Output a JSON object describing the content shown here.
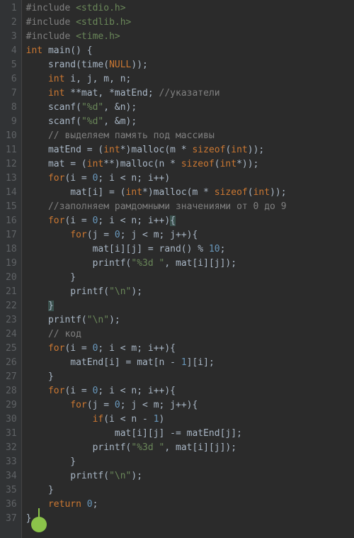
{
  "lines": [
    {
      "n": "1",
      "tokens": [
        {
          "c": "pp",
          "t": "#include "
        },
        {
          "c": "inc",
          "t": "<stdio.h>"
        }
      ]
    },
    {
      "n": "2",
      "tokens": [
        {
          "c": "pp",
          "t": "#include "
        },
        {
          "c": "inc",
          "t": "<stdlib.h>"
        }
      ]
    },
    {
      "n": "3",
      "tokens": [
        {
          "c": "pp",
          "t": "#include "
        },
        {
          "c": "inc",
          "t": "<time.h>"
        }
      ]
    },
    {
      "n": "4",
      "tokens": [
        {
          "c": "kw",
          "t": "int"
        },
        {
          "c": "id",
          "t": " main() {"
        }
      ]
    },
    {
      "n": "5",
      "tokens": [
        {
          "c": "id",
          "t": "    srand(time("
        },
        {
          "c": "kw",
          "t": "NULL"
        },
        {
          "c": "id",
          "t": "));"
        }
      ]
    },
    {
      "n": "6",
      "tokens": [
        {
          "c": "id",
          "t": "    "
        },
        {
          "c": "kw",
          "t": "int"
        },
        {
          "c": "id",
          "t": " i, j, m, n;"
        }
      ]
    },
    {
      "n": "7",
      "tokens": [
        {
          "c": "id",
          "t": "    "
        },
        {
          "c": "kw",
          "t": "int"
        },
        {
          "c": "id",
          "t": " **mat, *matEnd; "
        },
        {
          "c": "cmt",
          "t": "//указатели"
        }
      ]
    },
    {
      "n": "8",
      "tokens": [
        {
          "c": "id",
          "t": "    scanf("
        },
        {
          "c": "str",
          "t": "\"%d\""
        },
        {
          "c": "id",
          "t": ", &n);"
        }
      ]
    },
    {
      "n": "9",
      "tokens": [
        {
          "c": "id",
          "t": "    scanf("
        },
        {
          "c": "str",
          "t": "\"%d\""
        },
        {
          "c": "id",
          "t": ", &m);"
        }
      ]
    },
    {
      "n": "10",
      "tokens": [
        {
          "c": "id",
          "t": "    "
        },
        {
          "c": "cmt",
          "t": "// выделяем память под массивы"
        }
      ]
    },
    {
      "n": "11",
      "tokens": [
        {
          "c": "id",
          "t": "    matEnd = ("
        },
        {
          "c": "kw",
          "t": "int"
        },
        {
          "c": "id",
          "t": "*)malloc(m * "
        },
        {
          "c": "kw",
          "t": "sizeof"
        },
        {
          "c": "id",
          "t": "("
        },
        {
          "c": "kw",
          "t": "int"
        },
        {
          "c": "id",
          "t": "));"
        }
      ]
    },
    {
      "n": "12",
      "tokens": [
        {
          "c": "id",
          "t": "    mat = ("
        },
        {
          "c": "kw",
          "t": "int"
        },
        {
          "c": "id",
          "t": "**)malloc(n * "
        },
        {
          "c": "kw",
          "t": "sizeof"
        },
        {
          "c": "id",
          "t": "("
        },
        {
          "c": "kw",
          "t": "int"
        },
        {
          "c": "id",
          "t": "*));"
        }
      ]
    },
    {
      "n": "13",
      "tokens": [
        {
          "c": "id",
          "t": "    "
        },
        {
          "c": "kw",
          "t": "for"
        },
        {
          "c": "id",
          "t": "(i = "
        },
        {
          "c": "num",
          "t": "0"
        },
        {
          "c": "id",
          "t": "; i < n; i++)"
        }
      ]
    },
    {
      "n": "14",
      "tokens": [
        {
          "c": "id",
          "t": "        mat[i] = ("
        },
        {
          "c": "kw",
          "t": "int"
        },
        {
          "c": "id",
          "t": "*)malloc(m * "
        },
        {
          "c": "kw",
          "t": "sizeof"
        },
        {
          "c": "id",
          "t": "("
        },
        {
          "c": "kw",
          "t": "int"
        },
        {
          "c": "id",
          "t": "));"
        }
      ]
    },
    {
      "n": "15",
      "tokens": [
        {
          "c": "id",
          "t": "    "
        },
        {
          "c": "cmt",
          "t": "//заполняем рамдомными значениями от 0 до 9"
        }
      ]
    },
    {
      "n": "16",
      "tokens": [
        {
          "c": "id",
          "t": "    "
        },
        {
          "c": "kw",
          "t": "for"
        },
        {
          "c": "id",
          "t": "(i = "
        },
        {
          "c": "num",
          "t": "0"
        },
        {
          "c": "id",
          "t": "; i < n; i++)"
        },
        {
          "c": "brace-h",
          "t": "{"
        }
      ]
    },
    {
      "n": "17",
      "tokens": [
        {
          "c": "id",
          "t": "        "
        },
        {
          "c": "kw",
          "t": "for"
        },
        {
          "c": "id",
          "t": "(j = "
        },
        {
          "c": "num",
          "t": "0"
        },
        {
          "c": "id",
          "t": "; j < m; j++){"
        }
      ]
    },
    {
      "n": "18",
      "tokens": [
        {
          "c": "id",
          "t": "            mat[i][j] = rand() % "
        },
        {
          "c": "num",
          "t": "10"
        },
        {
          "c": "id",
          "t": ";"
        }
      ]
    },
    {
      "n": "19",
      "tokens": [
        {
          "c": "id",
          "t": "            printf("
        },
        {
          "c": "str",
          "t": "\"%3d \""
        },
        {
          "c": "id",
          "t": ", mat[i][j]);"
        }
      ]
    },
    {
      "n": "20",
      "tokens": [
        {
          "c": "id",
          "t": "        }"
        }
      ]
    },
    {
      "n": "21",
      "tokens": [
        {
          "c": "id",
          "t": "        printf("
        },
        {
          "c": "str",
          "t": "\"\\n\""
        },
        {
          "c": "id",
          "t": ");"
        }
      ]
    },
    {
      "n": "22",
      "tokens": [
        {
          "c": "id",
          "t": "    "
        },
        {
          "c": "brace-h",
          "t": "}"
        }
      ]
    },
    {
      "n": "23",
      "tokens": [
        {
          "c": "id",
          "t": "    printf("
        },
        {
          "c": "str",
          "t": "\"\\n\""
        },
        {
          "c": "id",
          "t": ");"
        }
      ]
    },
    {
      "n": "24",
      "tokens": [
        {
          "c": "id",
          "t": "    "
        },
        {
          "c": "cmt",
          "t": "// код"
        }
      ]
    },
    {
      "n": "25",
      "tokens": [
        {
          "c": "id",
          "t": "    "
        },
        {
          "c": "kw",
          "t": "for"
        },
        {
          "c": "id",
          "t": "(i = "
        },
        {
          "c": "num",
          "t": "0"
        },
        {
          "c": "id",
          "t": "; i < m; i++){"
        }
      ]
    },
    {
      "n": "26",
      "tokens": [
        {
          "c": "id",
          "t": "        matEnd[i] = mat[n - "
        },
        {
          "c": "num",
          "t": "1"
        },
        {
          "c": "id",
          "t": "][i];"
        }
      ]
    },
    {
      "n": "27",
      "tokens": [
        {
          "c": "id",
          "t": "    }"
        }
      ]
    },
    {
      "n": "28",
      "tokens": [
        {
          "c": "id",
          "t": "    "
        },
        {
          "c": "kw",
          "t": "for"
        },
        {
          "c": "id",
          "t": "(i = "
        },
        {
          "c": "num",
          "t": "0"
        },
        {
          "c": "id",
          "t": "; i < n; i++){"
        }
      ]
    },
    {
      "n": "29",
      "tokens": [
        {
          "c": "id",
          "t": "        "
        },
        {
          "c": "kw",
          "t": "for"
        },
        {
          "c": "id",
          "t": "(j = "
        },
        {
          "c": "num",
          "t": "0"
        },
        {
          "c": "id",
          "t": "; j < m; j++){"
        }
      ]
    },
    {
      "n": "30",
      "tokens": [
        {
          "c": "id",
          "t": "            "
        },
        {
          "c": "kw",
          "t": "if"
        },
        {
          "c": "id",
          "t": "(i < n - "
        },
        {
          "c": "num",
          "t": "1"
        },
        {
          "c": "id",
          "t": ")"
        }
      ]
    },
    {
      "n": "31",
      "tokens": [
        {
          "c": "id",
          "t": "                mat[i][j] -= matEnd[j];"
        }
      ]
    },
    {
      "n": "32",
      "tokens": [
        {
          "c": "id",
          "t": "            printf("
        },
        {
          "c": "str",
          "t": "\"%3d \""
        },
        {
          "c": "id",
          "t": ", mat[i][j]);"
        }
      ]
    },
    {
      "n": "33",
      "tokens": [
        {
          "c": "id",
          "t": "        }"
        }
      ]
    },
    {
      "n": "34",
      "tokens": [
        {
          "c": "id",
          "t": "        printf("
        },
        {
          "c": "str",
          "t": "\"\\n\""
        },
        {
          "c": "id",
          "t": ");"
        }
      ]
    },
    {
      "n": "35",
      "tokens": [
        {
          "c": "id",
          "t": "    }"
        }
      ]
    },
    {
      "n": "36",
      "tokens": [
        {
          "c": "id",
          "t": "    "
        },
        {
          "c": "kw",
          "t": "return"
        },
        {
          "c": "id",
          "t": " "
        },
        {
          "c": "num",
          "t": "0"
        },
        {
          "c": "id",
          "t": ";"
        }
      ]
    },
    {
      "n": "37",
      "tokens": [
        {
          "c": "id",
          "t": "}"
        }
      ]
    }
  ]
}
